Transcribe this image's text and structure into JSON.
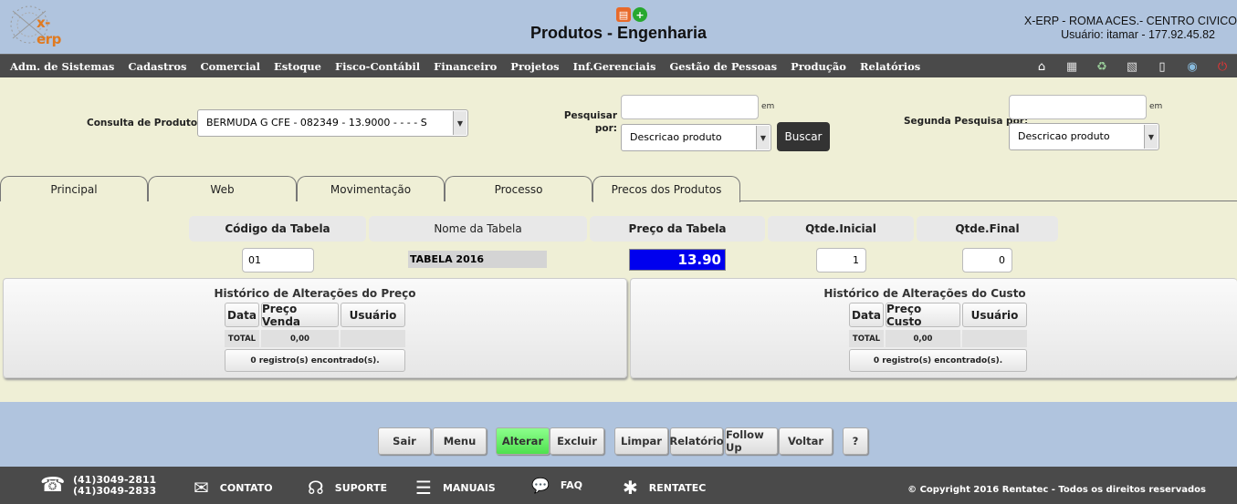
{
  "header": {
    "logo_text": "x-erp",
    "title": "Produtos - Engenharia",
    "company": "X-ERP - ROMA ACES.- CENTRO CIVICO",
    "user": "Usuário: itamar - 177.92.45.82"
  },
  "menu": [
    "Adm. de Sistemas",
    "Cadastros",
    "Comercial",
    "Estoque",
    "Fisco-Contábil",
    "Financeiro",
    "Projetos",
    "Inf.Gerenciais",
    "Gestão de Pessoas",
    "Produção",
    "Relatórios"
  ],
  "search": {
    "consulta_label": "Consulta de Produtos",
    "consulta_value": "BERMUDA G CFE - 082349 - 13.9000 - - - - S",
    "pesquisar_label_1": "Pesquisar",
    "pesquisar_label_2": "por:",
    "em_label": "em",
    "field_option": "Descricao produto",
    "buscar": "Buscar",
    "segunda_label": "Segunda Pesquisa por:",
    "segunda_option": "Descricao produto"
  },
  "tabs": [
    "Principal",
    "Web",
    "Movimentação",
    "Processo",
    "Precos dos Produtos"
  ],
  "price": {
    "headers": [
      "Código da Tabela",
      "Nome da Tabela",
      "Preço da Tabela",
      "Qtde.Inicial",
      "Qtde.Final"
    ],
    "codigo": "01",
    "nome": "TABELA 2016",
    "preco": "13.90",
    "qtde_inicial": "1",
    "qtde_final": "0"
  },
  "hist_preco": {
    "title": "Histórico de Alterações do Preço",
    "columns": [
      "Data",
      "Preço Venda",
      "Usuário"
    ],
    "total_label": "TOTAL",
    "total_value": "0,00",
    "footer": "0 registro(s) encontrado(s)."
  },
  "hist_custo": {
    "title": "Histórico de Alterações do Custo",
    "columns": [
      "Data",
      "Preço Custo",
      "Usuário"
    ],
    "total_label": "TOTAL",
    "total_value": "0,00",
    "footer": "0 registro(s) encontrado(s)."
  },
  "actions": [
    "Sair",
    "Menu",
    "Alterar",
    "Excluir",
    "Limpar",
    "Relatório",
    "Follow Up",
    "Voltar",
    "?"
  ],
  "footer": {
    "phone1": "(41)3049-2811",
    "phone2": "(41)3049-2833",
    "contato": "CONTATO",
    "suporte": "SUPORTE",
    "manuais": "MANUAIS",
    "faq": "FAQ",
    "rentatec": "RENTATEC",
    "copyright": "© Copyright 2016 Rentatec - Todos os direitos reservados"
  }
}
